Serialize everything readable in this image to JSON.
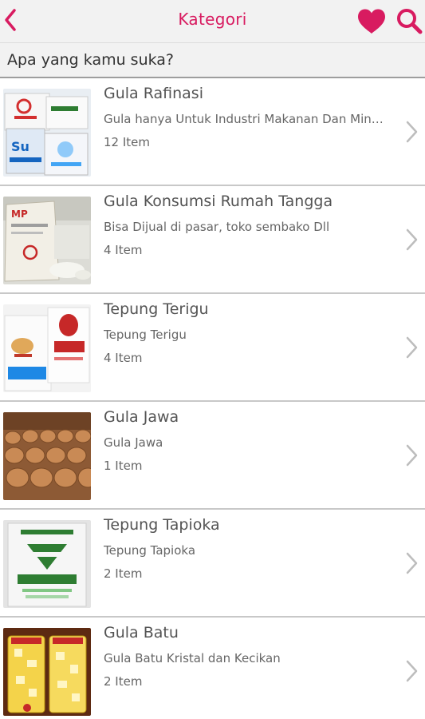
{
  "header": {
    "title": "Kategori",
    "accent_color": "#d81b60",
    "back_icon": "chevron-left-icon",
    "favorite_icon": "heart-icon",
    "search_icon": "search-icon"
  },
  "prompt": "Apa yang kamu suka?",
  "categories": [
    {
      "title": "Gula Rafinasi",
      "desc": "Gula hanya Untuk Industri Makanan Dan Minuman",
      "count": "12 Item"
    },
    {
      "title": "Gula Konsumsi Rumah Tangga",
      "desc": "Bisa Dijual di pasar, toko sembako Dll",
      "count": "4 Item"
    },
    {
      "title": "Tepung Terigu",
      "desc": "Tepung Terigu",
      "count": "4 Item"
    },
    {
      "title": "Gula Jawa",
      "desc": "Gula Jawa",
      "count": "1 Item"
    },
    {
      "title": "Tepung Tapioka",
      "desc": "Tepung Tapioka",
      "count": "2 Item"
    },
    {
      "title": "Gula Batu",
      "desc": "Gula Batu Kristal dan Kecikan",
      "count": "2 Item"
    }
  ]
}
